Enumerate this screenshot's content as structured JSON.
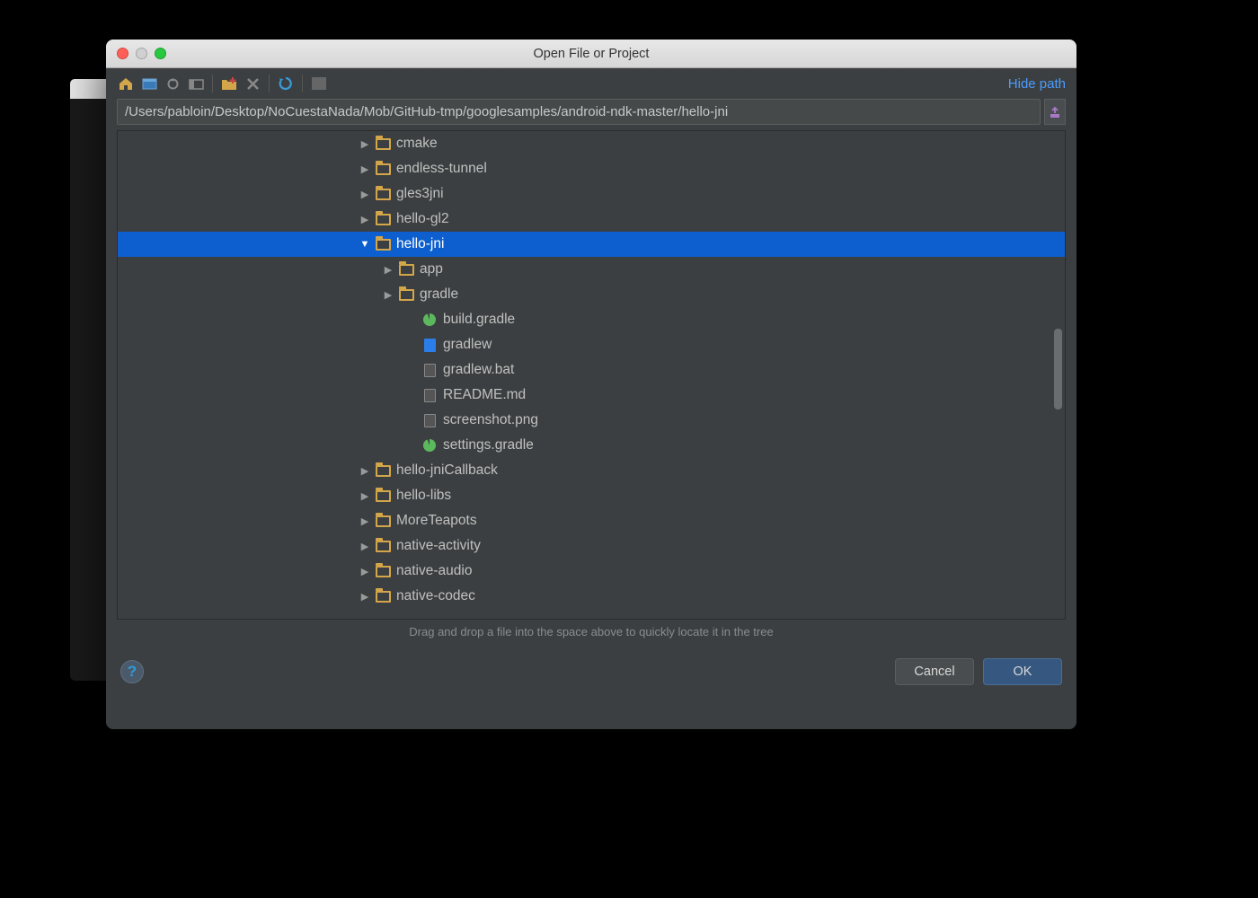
{
  "dialog": {
    "title": "Open File or Project",
    "hide_path": "Hide path",
    "path": "/Users/pabloin/Desktop/NoCuestaNada/Mob/GitHub-tmp/googlesamples/android-ndk-master/hello-jni",
    "hint": "Drag and drop a file into the space above to quickly locate it in the tree",
    "cancel": "Cancel",
    "ok": "OK"
  },
  "toolbar_icons": [
    "home",
    "desktop",
    "module",
    "project",
    "new-folder",
    "delete",
    "refresh",
    "hidden"
  ],
  "tree": [
    {
      "indent": 10,
      "type": "folder",
      "arrow": "right",
      "label": "cmake",
      "sel": false
    },
    {
      "indent": 10,
      "type": "folder",
      "arrow": "right",
      "label": "endless-tunnel",
      "sel": false
    },
    {
      "indent": 10,
      "type": "folder",
      "arrow": "right",
      "label": "gles3jni",
      "sel": false
    },
    {
      "indent": 10,
      "type": "folder",
      "arrow": "right",
      "label": "hello-gl2",
      "sel": false
    },
    {
      "indent": 10,
      "type": "folder",
      "arrow": "down",
      "label": "hello-jni",
      "sel": true
    },
    {
      "indent": 11,
      "type": "folder",
      "arrow": "right",
      "label": "app",
      "sel": false
    },
    {
      "indent": 11,
      "type": "folder",
      "arrow": "right",
      "label": "gradle",
      "sel": false
    },
    {
      "indent": 12,
      "type": "gradle",
      "arrow": "",
      "label": "build.gradle",
      "sel": false
    },
    {
      "indent": 12,
      "type": "sh",
      "arrow": "",
      "label": "gradlew",
      "sel": false
    },
    {
      "indent": 12,
      "type": "file",
      "arrow": "",
      "label": "gradlew.bat",
      "sel": false
    },
    {
      "indent": 12,
      "type": "file",
      "arrow": "",
      "label": "README.md",
      "sel": false
    },
    {
      "indent": 12,
      "type": "img",
      "arrow": "",
      "label": "screenshot.png",
      "sel": false
    },
    {
      "indent": 12,
      "type": "gradle",
      "arrow": "",
      "label": "settings.gradle",
      "sel": false
    },
    {
      "indent": 10,
      "type": "folder",
      "arrow": "right",
      "label": "hello-jniCallback",
      "sel": false
    },
    {
      "indent": 10,
      "type": "folder",
      "arrow": "right",
      "label": "hello-libs",
      "sel": false
    },
    {
      "indent": 10,
      "type": "folder",
      "arrow": "right",
      "label": "MoreTeapots",
      "sel": false
    },
    {
      "indent": 10,
      "type": "folder",
      "arrow": "right",
      "label": "native-activity",
      "sel": false
    },
    {
      "indent": 10,
      "type": "folder",
      "arrow": "right",
      "label": "native-audio",
      "sel": false
    },
    {
      "indent": 10,
      "type": "folder",
      "arrow": "right",
      "label": "native-codec",
      "sel": false
    }
  ]
}
